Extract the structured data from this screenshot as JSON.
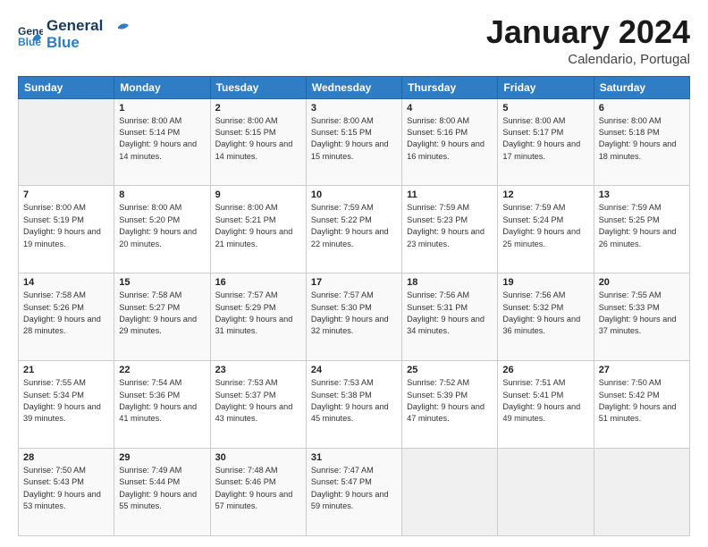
{
  "header": {
    "logo_line1": "General",
    "logo_line2": "Blue",
    "month_title": "January 2024",
    "subtitle": "Calendario, Portugal"
  },
  "weekdays": [
    "Sunday",
    "Monday",
    "Tuesday",
    "Wednesday",
    "Thursday",
    "Friday",
    "Saturday"
  ],
  "weeks": [
    [
      {
        "day": "",
        "sunrise": "",
        "sunset": "",
        "daylight": ""
      },
      {
        "day": "1",
        "sunrise": "Sunrise: 8:00 AM",
        "sunset": "Sunset: 5:14 PM",
        "daylight": "Daylight: 9 hours and 14 minutes."
      },
      {
        "day": "2",
        "sunrise": "Sunrise: 8:00 AM",
        "sunset": "Sunset: 5:15 PM",
        "daylight": "Daylight: 9 hours and 14 minutes."
      },
      {
        "day": "3",
        "sunrise": "Sunrise: 8:00 AM",
        "sunset": "Sunset: 5:15 PM",
        "daylight": "Daylight: 9 hours and 15 minutes."
      },
      {
        "day": "4",
        "sunrise": "Sunrise: 8:00 AM",
        "sunset": "Sunset: 5:16 PM",
        "daylight": "Daylight: 9 hours and 16 minutes."
      },
      {
        "day": "5",
        "sunrise": "Sunrise: 8:00 AM",
        "sunset": "Sunset: 5:17 PM",
        "daylight": "Daylight: 9 hours and 17 minutes."
      },
      {
        "day": "6",
        "sunrise": "Sunrise: 8:00 AM",
        "sunset": "Sunset: 5:18 PM",
        "daylight": "Daylight: 9 hours and 18 minutes."
      }
    ],
    [
      {
        "day": "7",
        "sunrise": "Sunrise: 8:00 AM",
        "sunset": "Sunset: 5:19 PM",
        "daylight": "Daylight: 9 hours and 19 minutes."
      },
      {
        "day": "8",
        "sunrise": "Sunrise: 8:00 AM",
        "sunset": "Sunset: 5:20 PM",
        "daylight": "Daylight: 9 hours and 20 minutes."
      },
      {
        "day": "9",
        "sunrise": "Sunrise: 8:00 AM",
        "sunset": "Sunset: 5:21 PM",
        "daylight": "Daylight: 9 hours and 21 minutes."
      },
      {
        "day": "10",
        "sunrise": "Sunrise: 7:59 AM",
        "sunset": "Sunset: 5:22 PM",
        "daylight": "Daylight: 9 hours and 22 minutes."
      },
      {
        "day": "11",
        "sunrise": "Sunrise: 7:59 AM",
        "sunset": "Sunset: 5:23 PM",
        "daylight": "Daylight: 9 hours and 23 minutes."
      },
      {
        "day": "12",
        "sunrise": "Sunrise: 7:59 AM",
        "sunset": "Sunset: 5:24 PM",
        "daylight": "Daylight: 9 hours and 25 minutes."
      },
      {
        "day": "13",
        "sunrise": "Sunrise: 7:59 AM",
        "sunset": "Sunset: 5:25 PM",
        "daylight": "Daylight: 9 hours and 26 minutes."
      }
    ],
    [
      {
        "day": "14",
        "sunrise": "Sunrise: 7:58 AM",
        "sunset": "Sunset: 5:26 PM",
        "daylight": "Daylight: 9 hours and 28 minutes."
      },
      {
        "day": "15",
        "sunrise": "Sunrise: 7:58 AM",
        "sunset": "Sunset: 5:27 PM",
        "daylight": "Daylight: 9 hours and 29 minutes."
      },
      {
        "day": "16",
        "sunrise": "Sunrise: 7:57 AM",
        "sunset": "Sunset: 5:29 PM",
        "daylight": "Daylight: 9 hours and 31 minutes."
      },
      {
        "day": "17",
        "sunrise": "Sunrise: 7:57 AM",
        "sunset": "Sunset: 5:30 PM",
        "daylight": "Daylight: 9 hours and 32 minutes."
      },
      {
        "day": "18",
        "sunrise": "Sunrise: 7:56 AM",
        "sunset": "Sunset: 5:31 PM",
        "daylight": "Daylight: 9 hours and 34 minutes."
      },
      {
        "day": "19",
        "sunrise": "Sunrise: 7:56 AM",
        "sunset": "Sunset: 5:32 PM",
        "daylight": "Daylight: 9 hours and 36 minutes."
      },
      {
        "day": "20",
        "sunrise": "Sunrise: 7:55 AM",
        "sunset": "Sunset: 5:33 PM",
        "daylight": "Daylight: 9 hours and 37 minutes."
      }
    ],
    [
      {
        "day": "21",
        "sunrise": "Sunrise: 7:55 AM",
        "sunset": "Sunset: 5:34 PM",
        "daylight": "Daylight: 9 hours and 39 minutes."
      },
      {
        "day": "22",
        "sunrise": "Sunrise: 7:54 AM",
        "sunset": "Sunset: 5:36 PM",
        "daylight": "Daylight: 9 hours and 41 minutes."
      },
      {
        "day": "23",
        "sunrise": "Sunrise: 7:53 AM",
        "sunset": "Sunset: 5:37 PM",
        "daylight": "Daylight: 9 hours and 43 minutes."
      },
      {
        "day": "24",
        "sunrise": "Sunrise: 7:53 AM",
        "sunset": "Sunset: 5:38 PM",
        "daylight": "Daylight: 9 hours and 45 minutes."
      },
      {
        "day": "25",
        "sunrise": "Sunrise: 7:52 AM",
        "sunset": "Sunset: 5:39 PM",
        "daylight": "Daylight: 9 hours and 47 minutes."
      },
      {
        "day": "26",
        "sunrise": "Sunrise: 7:51 AM",
        "sunset": "Sunset: 5:41 PM",
        "daylight": "Daylight: 9 hours and 49 minutes."
      },
      {
        "day": "27",
        "sunrise": "Sunrise: 7:50 AM",
        "sunset": "Sunset: 5:42 PM",
        "daylight": "Daylight: 9 hours and 51 minutes."
      }
    ],
    [
      {
        "day": "28",
        "sunrise": "Sunrise: 7:50 AM",
        "sunset": "Sunset: 5:43 PM",
        "daylight": "Daylight: 9 hours and 53 minutes."
      },
      {
        "day": "29",
        "sunrise": "Sunrise: 7:49 AM",
        "sunset": "Sunset: 5:44 PM",
        "daylight": "Daylight: 9 hours and 55 minutes."
      },
      {
        "day": "30",
        "sunrise": "Sunrise: 7:48 AM",
        "sunset": "Sunset: 5:46 PM",
        "daylight": "Daylight: 9 hours and 57 minutes."
      },
      {
        "day": "31",
        "sunrise": "Sunrise: 7:47 AM",
        "sunset": "Sunset: 5:47 PM",
        "daylight": "Daylight: 9 hours and 59 minutes."
      },
      {
        "day": "",
        "sunrise": "",
        "sunset": "",
        "daylight": ""
      },
      {
        "day": "",
        "sunrise": "",
        "sunset": "",
        "daylight": ""
      },
      {
        "day": "",
        "sunrise": "",
        "sunset": "",
        "daylight": ""
      }
    ]
  ]
}
